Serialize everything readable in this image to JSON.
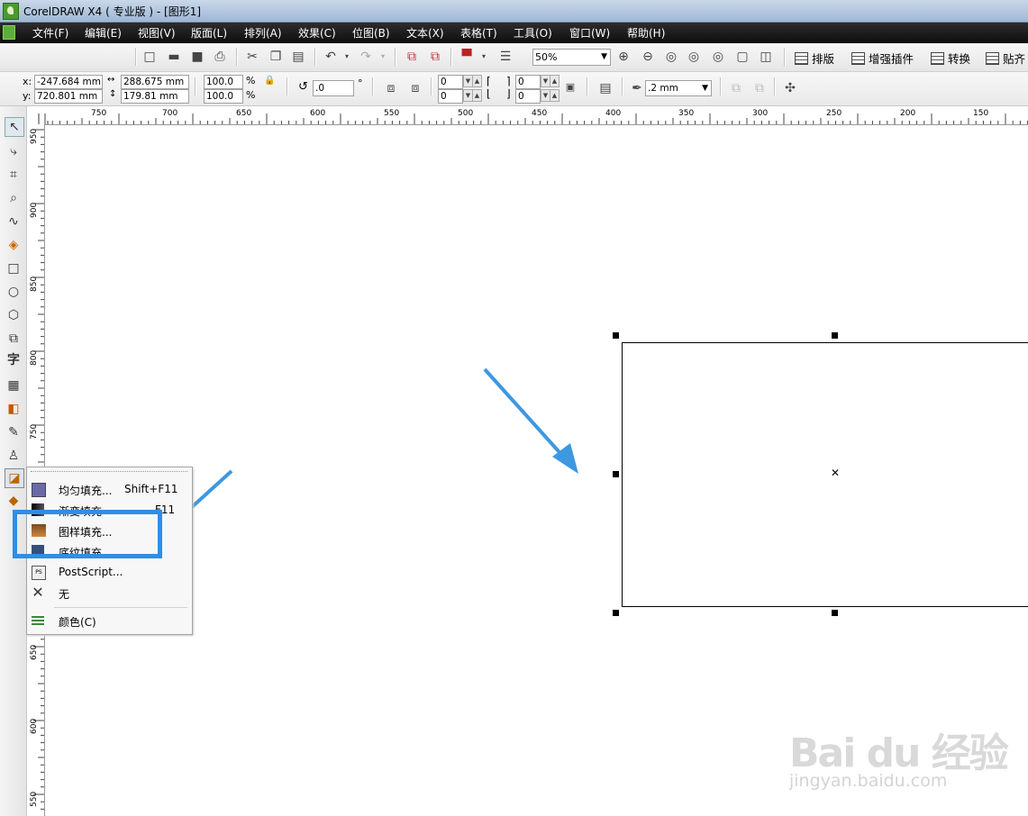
{
  "window": {
    "title": "CorelDRAW X4 ( 专业版 ) - [图形1]"
  },
  "menu": [
    "文件(F)",
    "编辑(E)",
    "视图(V)",
    "版面(L)",
    "排列(A)",
    "效果(C)",
    "位图(B)",
    "文本(X)",
    "表格(T)",
    "工具(O)",
    "窗口(W)",
    "帮助(H)"
  ],
  "toolbar": {
    "zoom": "50%",
    "right_buttons": [
      "排版",
      "增强插件",
      "转换",
      "贴齐"
    ]
  },
  "property_bar": {
    "x_label": "x:",
    "x": "-247.684 mm",
    "y_label": "y:",
    "y": "720.801 mm",
    "width": "288.675 mm",
    "height": "179.81 mm",
    "scale_x": "100.0",
    "scale_y": "100.0",
    "percent": "%",
    "rotation": ".0",
    "degree": "°",
    "corner_values": [
      "0",
      "0",
      "0",
      "0"
    ],
    "outline_width": ".2 mm"
  },
  "ruler": {
    "h_labels": [
      "750",
      "700",
      "650",
      "600",
      "550",
      "500",
      "450",
      "400",
      "350",
      "300",
      "250",
      "200",
      "150"
    ],
    "v_labels": [
      "950",
      "900",
      "850",
      "800",
      "750",
      "650",
      "600",
      "550",
      "500"
    ]
  },
  "fill_flyout": {
    "items": [
      {
        "label": "均匀填充...",
        "shortcut": "Shift+F11",
        "icon": "uniform-fill-icon"
      },
      {
        "label": "渐变填充",
        "shortcut": "F11",
        "icon": "fountain-fill-icon"
      },
      {
        "label": "图样填充...",
        "shortcut": "",
        "icon": "pattern-fill-icon"
      },
      {
        "label": "底纹填充",
        "shortcut": "",
        "icon": "texture-fill-icon"
      },
      {
        "label": "PostScript...",
        "shortcut": "",
        "icon": "postscript-fill-icon"
      },
      {
        "label": "无",
        "shortcut": "",
        "icon": "no-fill-icon"
      },
      {
        "label": "颜色(C)",
        "shortcut": "",
        "icon": "color-docker-icon"
      }
    ],
    "highlighted": "图样填充..."
  },
  "watermark": {
    "logo": "Bai du 经验",
    "url": "jingyan.baidu.com"
  },
  "colors": {
    "arrow": "#3d98e0",
    "highlight": "#2e8ee6",
    "menubar": "#1a1a1a"
  }
}
